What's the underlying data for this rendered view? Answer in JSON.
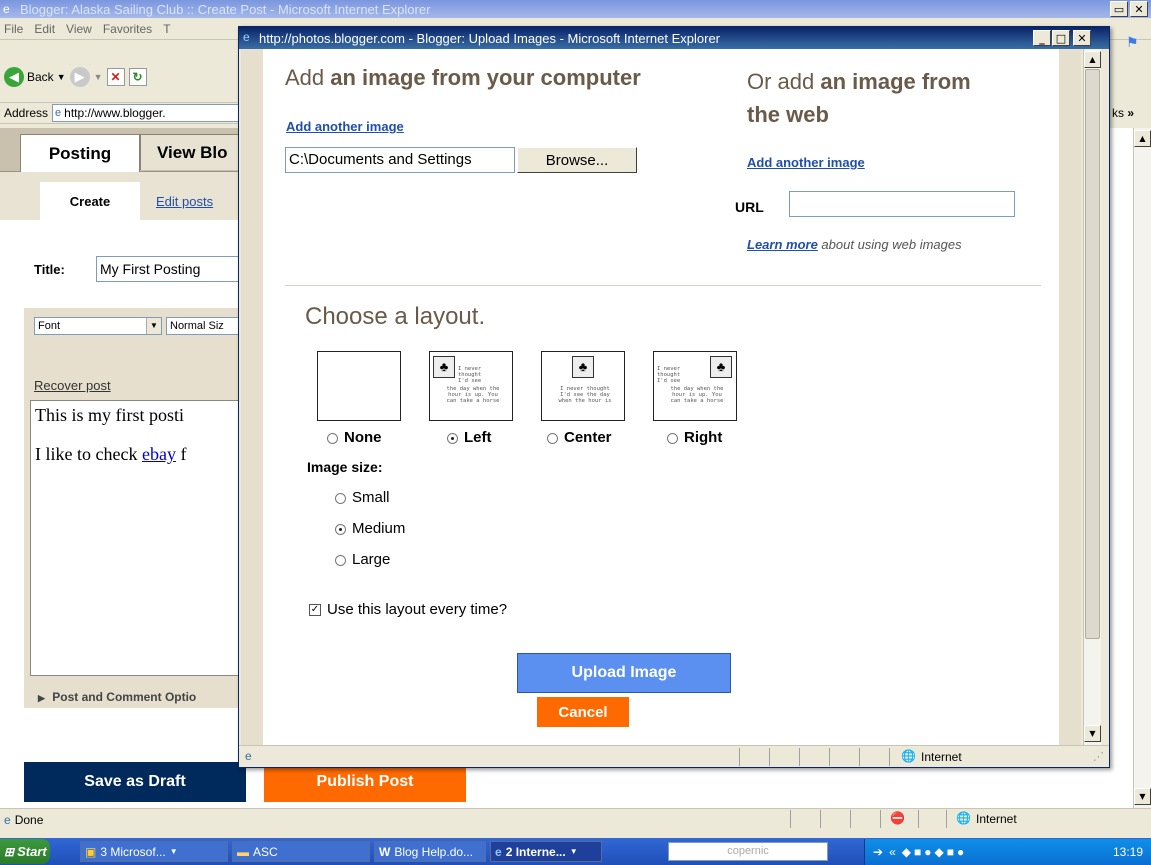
{
  "parent_window": {
    "title": "Blogger: Alaska Sailing Club :: Create Post - Microsoft Internet Explorer",
    "menu": [
      "File",
      "Edit",
      "View",
      "Favorites",
      "T"
    ],
    "back_label": "Back",
    "address_label": "Address",
    "address_value": "http://www.blogger.",
    "links_label": "ks",
    "tabs": {
      "posting": "Posting",
      "view_blog": "View Blo"
    },
    "subtabs": {
      "create": "Create",
      "edit_posts": "Edit posts"
    },
    "title_label": "Title:",
    "title_value": "My First Posting",
    "font_select": "Font",
    "size_select": "Normal Siz",
    "recover_post": "Recover post",
    "body_line1": "This is my first posti",
    "body_line2_prefix": "I like to check ",
    "body_link": "ebay",
    "body_line2_suffix": " f",
    "post_options": "Post and Comment Optio",
    "save_draft": "Save as Draft",
    "publish": "Publish Post",
    "status": "Done",
    "zone": "Internet"
  },
  "popup": {
    "title": "http://photos.blogger.com - Blogger: Upload Images - Microsoft Internet Explorer",
    "computer_heading_pre": "Add ",
    "computer_heading_bold": "an image from your computer",
    "add_another_left": "Add another image",
    "file_value": "C:\\Documents and Settings",
    "browse": "Browse...",
    "web_heading_pre": "Or add ",
    "web_heading_bold1": "an image from",
    "web_heading_bold2": "the web",
    "add_another_right": "Add another image",
    "url_label": "URL",
    "url_value": "",
    "learn_more": "Learn more",
    "learn_more_rest": " about using web images",
    "layout_heading": "Choose a layout.",
    "layouts": [
      {
        "label": "None",
        "selected": false
      },
      {
        "label": "Left",
        "selected": true
      },
      {
        "label": "Center",
        "selected": false
      },
      {
        "label": "Right",
        "selected": false
      }
    ],
    "thumb_text": [
      "I never",
      "thought",
      "I'd see",
      "the day when the",
      "hour is up. You",
      "can take a horse"
    ],
    "thumb_text_center": [
      "I never thought",
      "I'd see the day",
      "when the hour is"
    ],
    "image_size_label": "Image size",
    "sizes": [
      {
        "label": "Small",
        "selected": false
      },
      {
        "label": "Medium",
        "selected": true
      },
      {
        "label": "Large",
        "selected": false
      }
    ],
    "every_time": "Use this layout every time?",
    "upload": "Upload Image",
    "cancel": "Cancel",
    "zone": "Internet"
  },
  "taskbar": {
    "start": "Start",
    "items": [
      "3 Microsof...",
      "ASC",
      "Blog Help.do...",
      "2 Interne...",
      "copernic"
    ],
    "clock": "13:19"
  },
  "colors": {
    "accent_blue": "#5b8ff0",
    "cancel_orange": "#ff6a00",
    "navy": "#002a5c"
  }
}
